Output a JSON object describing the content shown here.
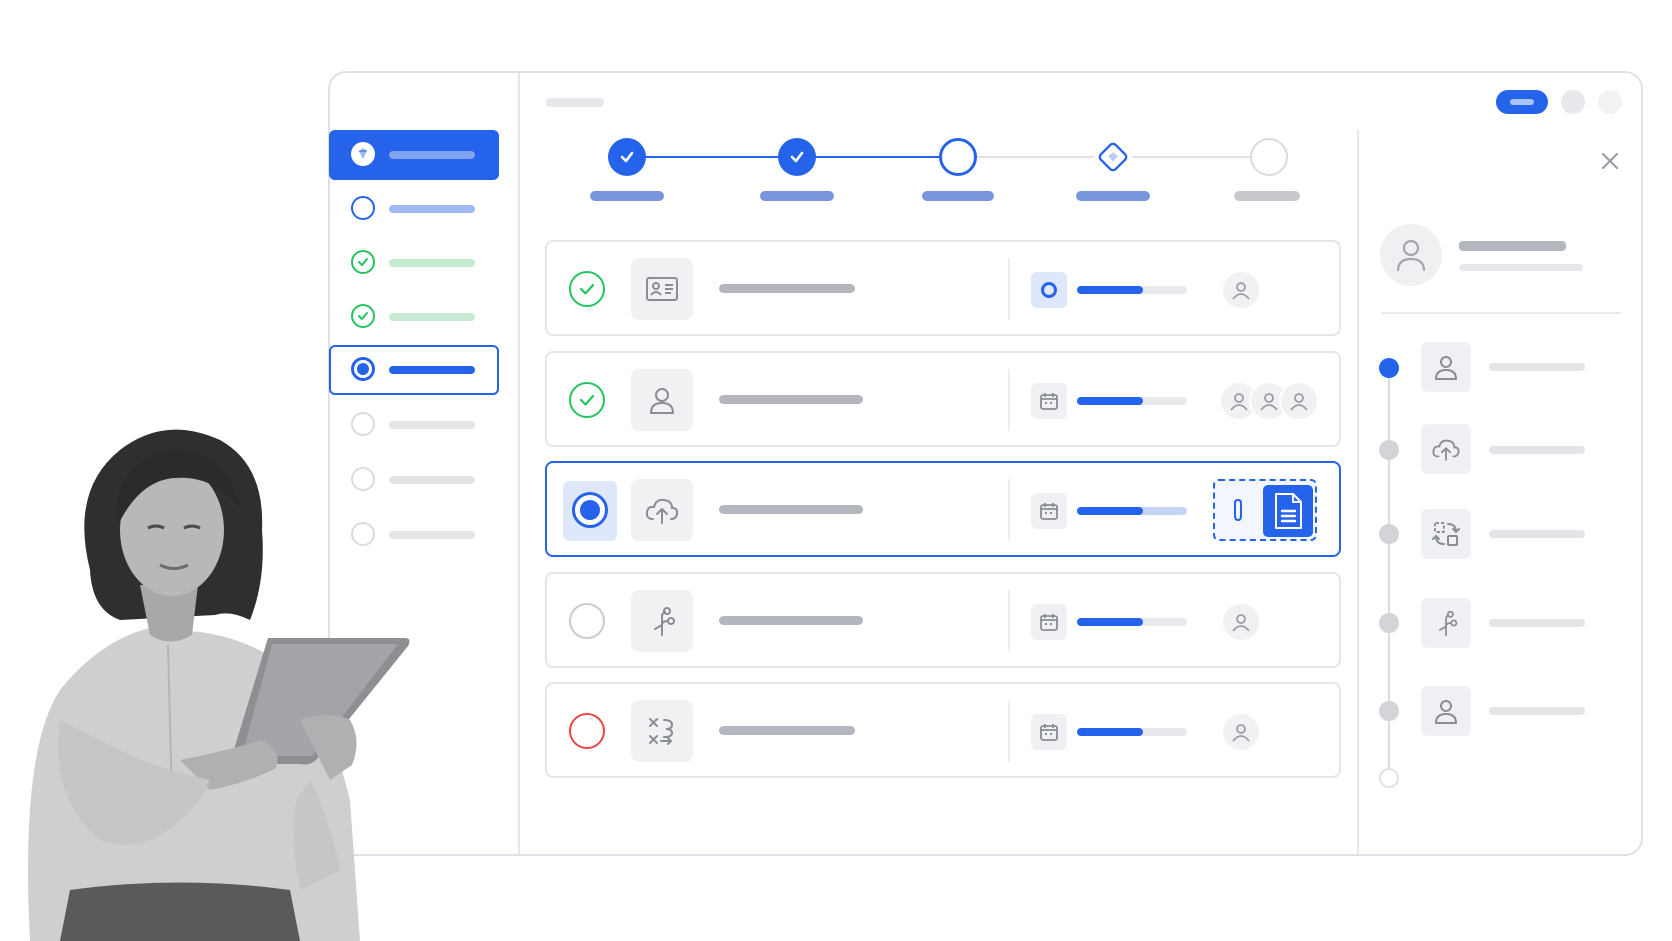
{
  "colors": {
    "accent": "#2563eb",
    "accent_light": "#8fb0f0",
    "success": "#22c55e",
    "success_light": "#c6ead2",
    "error": "#ef4444",
    "neutral": "#d9dbe0"
  },
  "sidebar": {
    "items": [
      {
        "state": "selected",
        "icon": "brand-gem-icon"
      },
      {
        "state": "in-progress",
        "icon": "circle-outline-icon"
      },
      {
        "state": "complete",
        "icon": "check-circle-icon"
      },
      {
        "state": "complete",
        "icon": "check-circle-icon"
      },
      {
        "state": "current",
        "icon": "radio-filled-icon"
      },
      {
        "state": "pending",
        "icon": "circle-outline-icon"
      },
      {
        "state": "pending",
        "icon": "circle-outline-icon"
      },
      {
        "state": "pending",
        "icon": "circle-outline-icon"
      }
    ]
  },
  "header": {
    "actions": [
      {
        "name": "primary-action-button",
        "icon": "pill-button-icon"
      },
      {
        "name": "secondary-action-button",
        "icon": "circle-icon"
      },
      {
        "name": "tertiary-action-button",
        "icon": "circle-icon"
      }
    ]
  },
  "stepper": {
    "steps": [
      {
        "state": "complete",
        "icon": "check-icon"
      },
      {
        "state": "complete",
        "icon": "check-icon"
      },
      {
        "state": "current",
        "icon": "ring-icon"
      },
      {
        "state": "milestone",
        "icon": "diamond-gem-icon"
      },
      {
        "state": "pending",
        "icon": "circle-outline-icon"
      }
    ]
  },
  "tasks": [
    {
      "status": "complete",
      "type_icon": "id-card-icon",
      "meta_icon": "radio-ring-icon",
      "progress": 0.6,
      "assignees": 1
    },
    {
      "status": "complete",
      "type_icon": "user-icon",
      "meta_icon": "calendar-icon",
      "progress": 0.6,
      "assignees": 3
    },
    {
      "status": "active",
      "type_icon": "cloud-upload-icon",
      "meta_icon": "calendar-icon",
      "progress": 0.6,
      "attachment": true
    },
    {
      "status": "pending",
      "type_icon": "branch-icon",
      "meta_icon": "calendar-icon",
      "progress": 0.6,
      "assignees": 1
    },
    {
      "status": "error",
      "type_icon": "shuffle-icon",
      "meta_icon": "calendar-icon",
      "progress": 0.6,
      "assignees": 1
    }
  ],
  "detail_panel": {
    "close_icon": "close-icon",
    "avatar_icon": "user-avatar-icon",
    "timeline": [
      {
        "state": "current",
        "icon": "user-icon"
      },
      {
        "state": "pending",
        "icon": "cloud-upload-icon"
      },
      {
        "state": "pending",
        "icon": "transform-icon"
      },
      {
        "state": "pending",
        "icon": "branch-icon"
      },
      {
        "state": "pending",
        "icon": "user-icon"
      },
      {
        "state": "empty"
      }
    ]
  },
  "photo": {
    "subject": "woman-with-tablet"
  }
}
